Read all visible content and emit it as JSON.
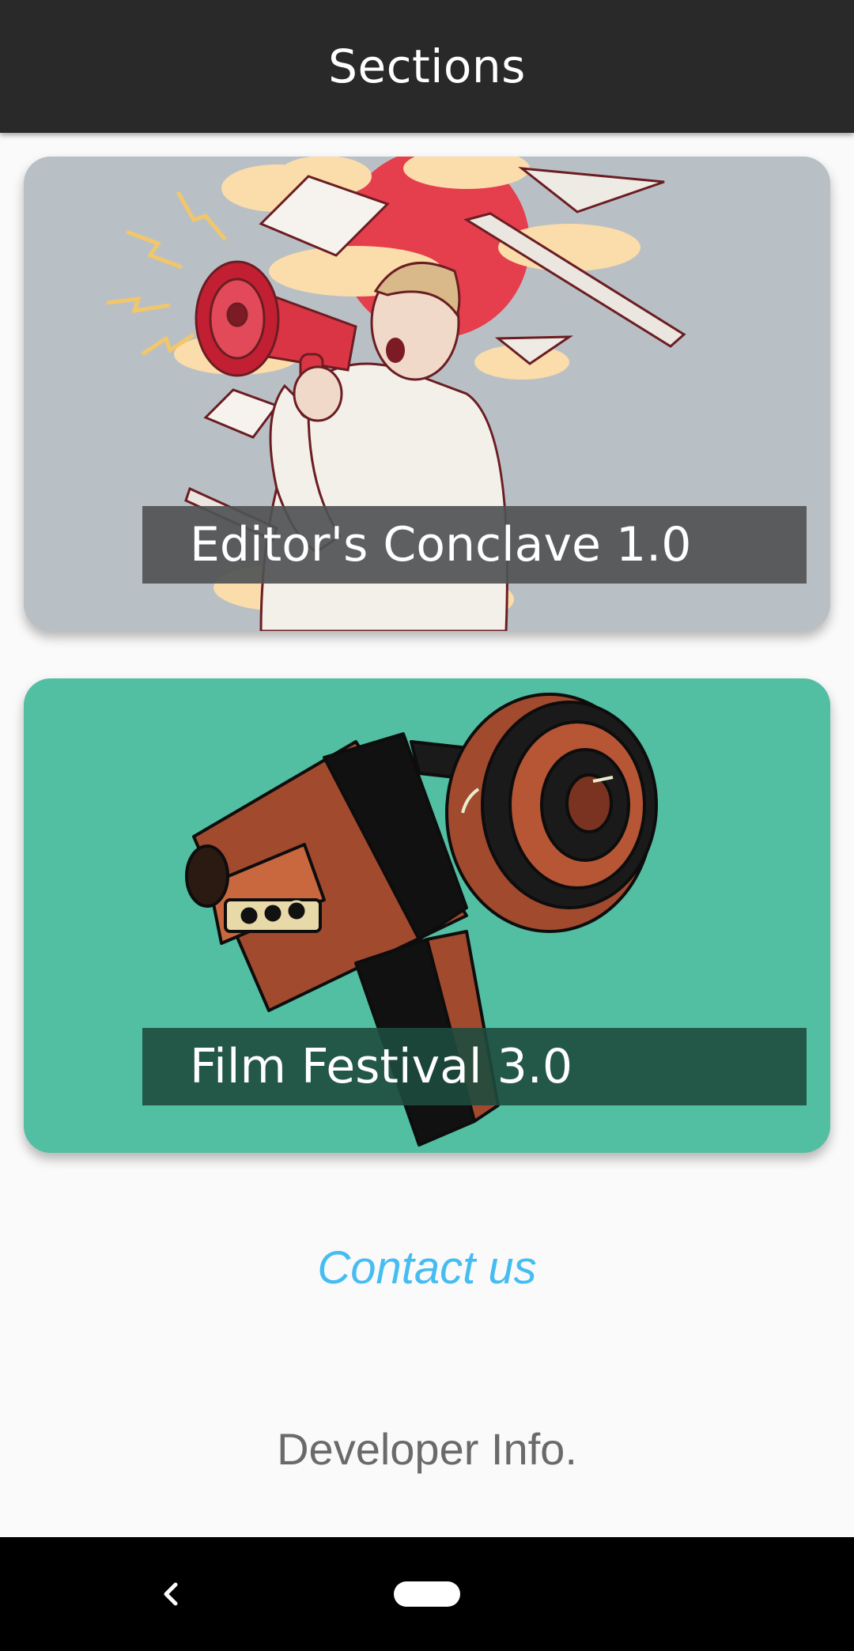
{
  "appbar": {
    "title": "Sections"
  },
  "sections": [
    {
      "title": "Editor's Conclave 1.0",
      "bg": "#b9c0c5",
      "art": "megaphone-illustration"
    },
    {
      "title": "Film Festival 3.0",
      "bg": "#52bea2",
      "art": "movie-camera-illustration"
    }
  ],
  "links": {
    "contact": "Contact us",
    "developer": "Developer Info."
  },
  "navbar": {
    "back_icon": "back-chevron-icon",
    "home_icon": "home-pill-icon"
  },
  "colors": {
    "appbar": "#292929",
    "link": "#45bdf1",
    "muted_text": "#6a6a6a"
  }
}
